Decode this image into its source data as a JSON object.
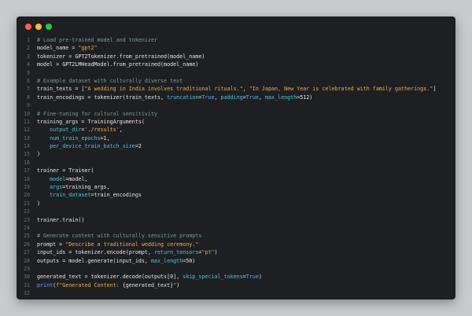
{
  "window": {
    "buttons": [
      {
        "name": "close-dot",
        "color": "#ff5f56"
      },
      {
        "name": "minimize-dot",
        "color": "#ffbd2e"
      },
      {
        "name": "maximize-dot",
        "color": "#27c93f"
      }
    ]
  },
  "code_lines": [
    [
      {
        "t": "# Load pre-trained model and tokenizer",
        "c": "comment"
      }
    ],
    [
      {
        "t": "model_name = ",
        "c": "plain"
      },
      {
        "t": "\"gpt2\"",
        "c": "string"
      }
    ],
    [
      {
        "t": "tokenizer = GPT2Tokenizer.from_pretrained(model_name)",
        "c": "plain"
      }
    ],
    [
      {
        "t": "model = GPT2LMHeadModel.from_pretrained(model_name)",
        "c": "plain"
      }
    ],
    [],
    [
      {
        "t": "# Example dataset with culturally diverse text",
        "c": "comment"
      }
    ],
    [
      {
        "t": "train_texts = [",
        "c": "plain"
      },
      {
        "t": "\"A wedding in India involves traditional rituals.\"",
        "c": "string"
      },
      {
        "t": ", ",
        "c": "plain"
      },
      {
        "t": "\"In Japan, New Year is celebrated with family gatherings.\"",
        "c": "string"
      },
      {
        "t": "]",
        "c": "plain"
      }
    ],
    [
      {
        "t": "train_encodings = tokenizer(train_texts, ",
        "c": "plain"
      },
      {
        "t": "truncation",
        "c": "param"
      },
      {
        "t": "=",
        "c": "plain"
      },
      {
        "t": "True",
        "c": "kw"
      },
      {
        "t": ", ",
        "c": "plain"
      },
      {
        "t": "padding",
        "c": "param"
      },
      {
        "t": "=",
        "c": "plain"
      },
      {
        "t": "True",
        "c": "kw"
      },
      {
        "t": ", ",
        "c": "plain"
      },
      {
        "t": "max_length",
        "c": "param"
      },
      {
        "t": "=512)",
        "c": "plain"
      }
    ],
    [],
    [
      {
        "t": "# Fine-tuning for cultural sensitivity",
        "c": "comment"
      }
    ],
    [
      {
        "t": "training_args = TrainingArguments(",
        "c": "plain"
      }
    ],
    [
      {
        "t": "    ",
        "c": "plain"
      },
      {
        "t": "output_dir",
        "c": "param"
      },
      {
        "t": "=",
        "c": "plain"
      },
      {
        "t": "'./results'",
        "c": "string"
      },
      {
        "t": ",",
        "c": "plain"
      }
    ],
    [
      {
        "t": "    ",
        "c": "plain"
      },
      {
        "t": "num_train_epochs",
        "c": "param"
      },
      {
        "t": "=1,",
        "c": "plain"
      }
    ],
    [
      {
        "t": "    ",
        "c": "plain"
      },
      {
        "t": "per_device_train_batch_size",
        "c": "param"
      },
      {
        "t": "=2",
        "c": "plain"
      }
    ],
    [
      {
        "t": ")",
        "c": "plain"
      }
    ],
    [],
    [
      {
        "t": "trainer = Trainer(",
        "c": "plain"
      }
    ],
    [
      {
        "t": "    ",
        "c": "plain"
      },
      {
        "t": "model",
        "c": "param"
      },
      {
        "t": "=model,",
        "c": "plain"
      }
    ],
    [
      {
        "t": "    ",
        "c": "plain"
      },
      {
        "t": "args",
        "c": "param"
      },
      {
        "t": "=training_args,",
        "c": "plain"
      }
    ],
    [
      {
        "t": "    ",
        "c": "plain"
      },
      {
        "t": "train_dataset",
        "c": "param"
      },
      {
        "t": "=train_encodings",
        "c": "plain"
      }
    ],
    [
      {
        "t": ")",
        "c": "plain"
      }
    ],
    [],
    [
      {
        "t": "trainer.train()",
        "c": "plain"
      }
    ],
    [],
    [
      {
        "t": "# Generate content with culturally sensitive prompts",
        "c": "comment"
      }
    ],
    [
      {
        "t": "prompt = ",
        "c": "plain"
      },
      {
        "t": "\"Describe a traditional wedding ceremony.\"",
        "c": "string"
      }
    ],
    [
      {
        "t": "input_ids = tokenizer.encode(prompt, ",
        "c": "plain"
      },
      {
        "t": "return_tensors",
        "c": "param"
      },
      {
        "t": "=",
        "c": "plain"
      },
      {
        "t": "\"pt\"",
        "c": "string"
      },
      {
        "t": ")",
        "c": "plain"
      }
    ],
    [
      {
        "t": "outputs = model.generate(input_ids, ",
        "c": "plain"
      },
      {
        "t": "max_length",
        "c": "param"
      },
      {
        "t": "=50)",
        "c": "plain"
      }
    ],
    [],
    [
      {
        "t": "generated_text = tokenizer.decode(outputs[0], ",
        "c": "plain"
      },
      {
        "t": "skip_special_tokens",
        "c": "param"
      },
      {
        "t": "=",
        "c": "plain"
      },
      {
        "t": "True",
        "c": "kw"
      },
      {
        "t": ")",
        "c": "plain"
      }
    ],
    [
      {
        "t": "print",
        "c": "kw"
      },
      {
        "t": "(",
        "c": "plain"
      },
      {
        "t": "f\"Generated Content: ",
        "c": "string"
      },
      {
        "t": "{generated_text}",
        "c": "plain"
      },
      {
        "t": "\"",
        "c": "string"
      },
      {
        "t": ")",
        "c": "plain"
      }
    ],
    []
  ]
}
